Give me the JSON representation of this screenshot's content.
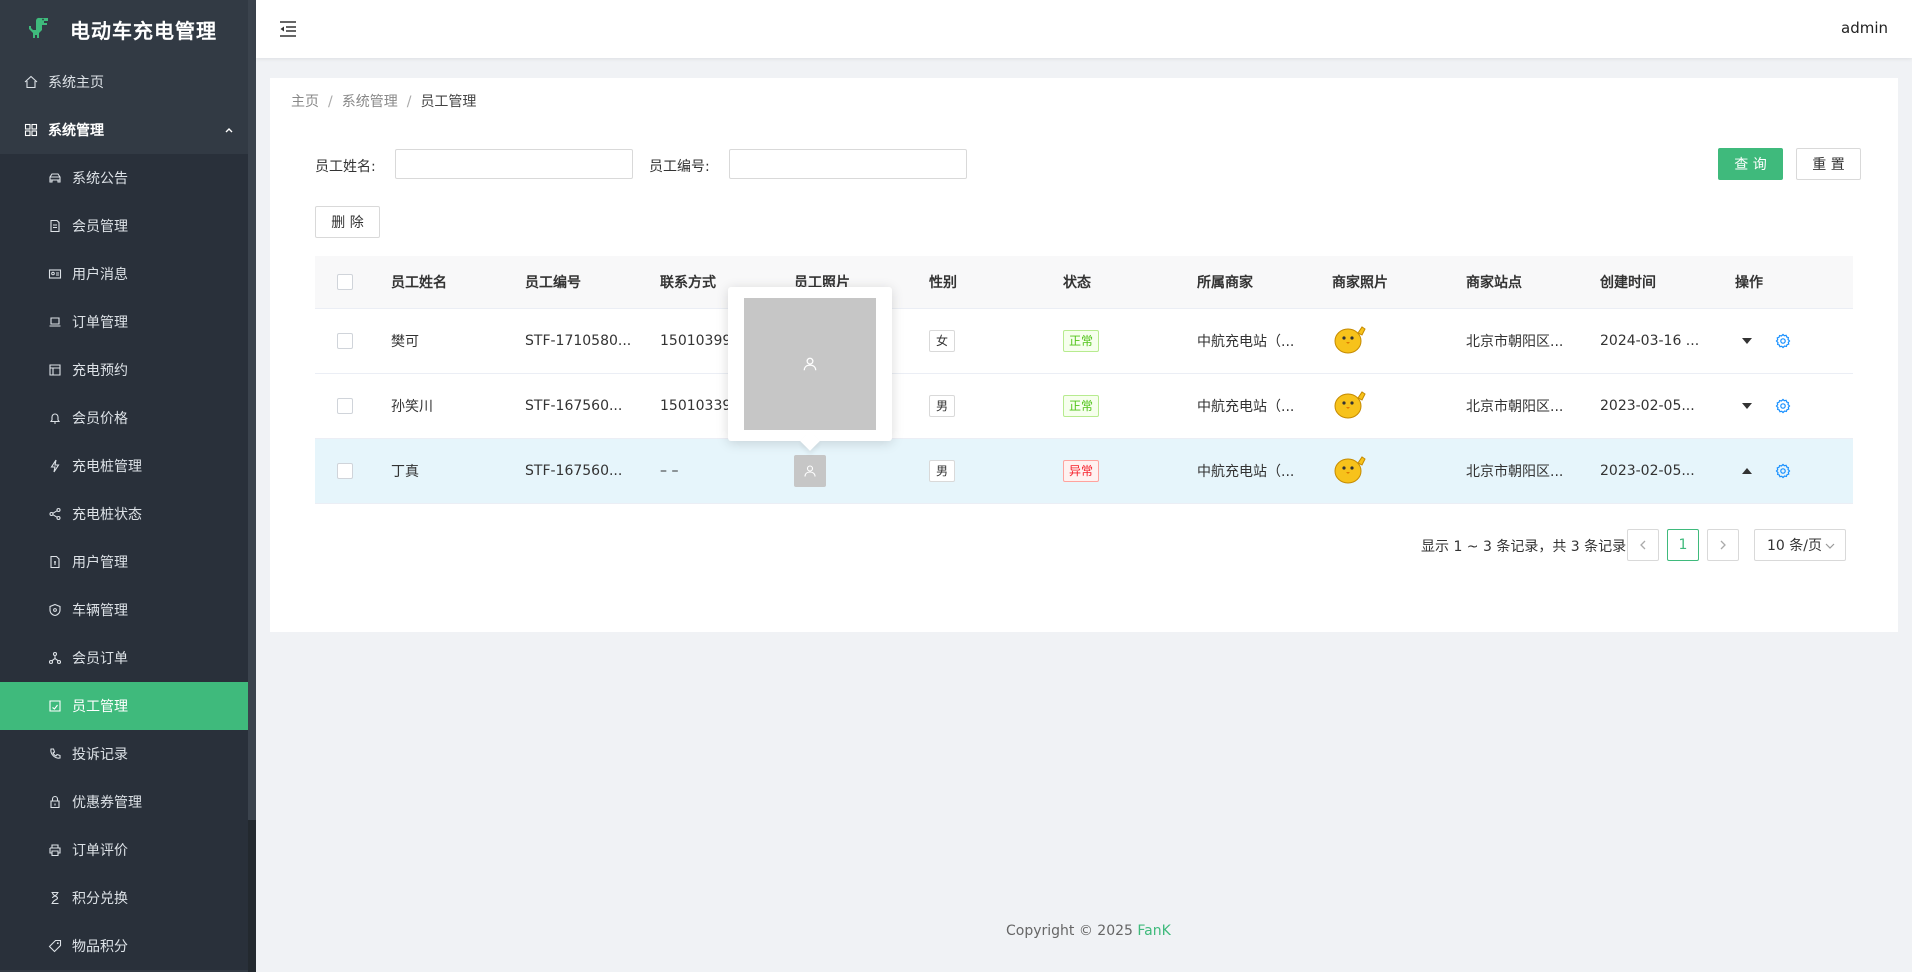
{
  "app": {
    "title": "电动车充电管理"
  },
  "header": {
    "username": "admin"
  },
  "sidebar": {
    "home": {
      "label": "系统主页",
      "icon": "home-icon"
    },
    "group": {
      "label": "系统管理",
      "icon": "grid-icon"
    },
    "items": [
      {
        "label": "系统公告",
        "icon": "car-icon"
      },
      {
        "label": "会员管理",
        "icon": "document-icon"
      },
      {
        "label": "用户消息",
        "icon": "id-card-icon"
      },
      {
        "label": "订单管理",
        "icon": "laptop-icon"
      },
      {
        "label": "充电预约",
        "icon": "calendar-icon"
      },
      {
        "label": "会员价格",
        "icon": "bell-icon"
      },
      {
        "label": "充电桩管理",
        "icon": "lightning-icon"
      },
      {
        "label": "充电桩状态",
        "icon": "share-icon"
      },
      {
        "label": "用户管理",
        "icon": "file-icon"
      },
      {
        "label": "车辆管理",
        "icon": "shield-icon"
      },
      {
        "label": "会员订单",
        "icon": "cluster-icon"
      },
      {
        "label": "员工管理",
        "icon": "profile-icon",
        "active": true
      },
      {
        "label": "投诉记录",
        "icon": "phone-icon"
      },
      {
        "label": "优惠券管理",
        "icon": "lock-icon"
      },
      {
        "label": "订单评价",
        "icon": "printer-icon"
      },
      {
        "label": "积分兑换",
        "icon": "hourglass-icon"
      },
      {
        "label": "物品积分",
        "icon": "tag-icon"
      }
    ]
  },
  "breadcrumb": {
    "home": "主页",
    "parent": "系统管理",
    "current": "员工管理",
    "separator": "/"
  },
  "search": {
    "name_label": "员工姓名:",
    "no_label": "员工编号:",
    "name_value": "",
    "no_value": "",
    "query_label": "查 询",
    "reset_label": "重 置"
  },
  "toolbar": {
    "delete_label": "删 除"
  },
  "table": {
    "columns": [
      "员工姓名",
      "员工编号",
      "联系方式",
      "员工照片",
      "性别",
      "状态",
      "所属商家",
      "商家照片",
      "商家站点",
      "创建时间",
      "操作"
    ],
    "rows": [
      {
        "name": "樊可",
        "no": "STF-1710580...",
        "phone": "150103993...",
        "sex": "女",
        "status": "正常",
        "status_type": "ok",
        "merchant": "中航充电站（...",
        "site": "北京市朝阳区...",
        "time": "2024-03-16 ...",
        "op_arrow": "down"
      },
      {
        "name": "孙笑川",
        "no": "STF-167560...",
        "phone": "150103392...",
        "sex": "男",
        "status": "正常",
        "status_type": "ok",
        "merchant": "中航充电站（...",
        "site": "北京市朝阳区...",
        "time": "2023-02-05...",
        "op_arrow": "down"
      },
      {
        "name": "丁真",
        "no": "STF-167560...",
        "phone": "– –",
        "sex": "男",
        "status": "异常",
        "status_type": "bad",
        "merchant": "中航充电站（...",
        "site": "北京市朝阳区...",
        "time": "2023-02-05...",
        "op_arrow": "up"
      }
    ]
  },
  "pagination": {
    "info": "显示 1 ~ 3 条记录，共 3 条记录",
    "current_page": "1",
    "page_size": "10 条/页"
  },
  "footer": {
    "copyright": "Copyright © 2025 ",
    "brand": "FanK"
  },
  "colors": {
    "accent": "#3fba7c",
    "sidebar_bg": "#323a44",
    "submenu_bg": "#29303a"
  }
}
